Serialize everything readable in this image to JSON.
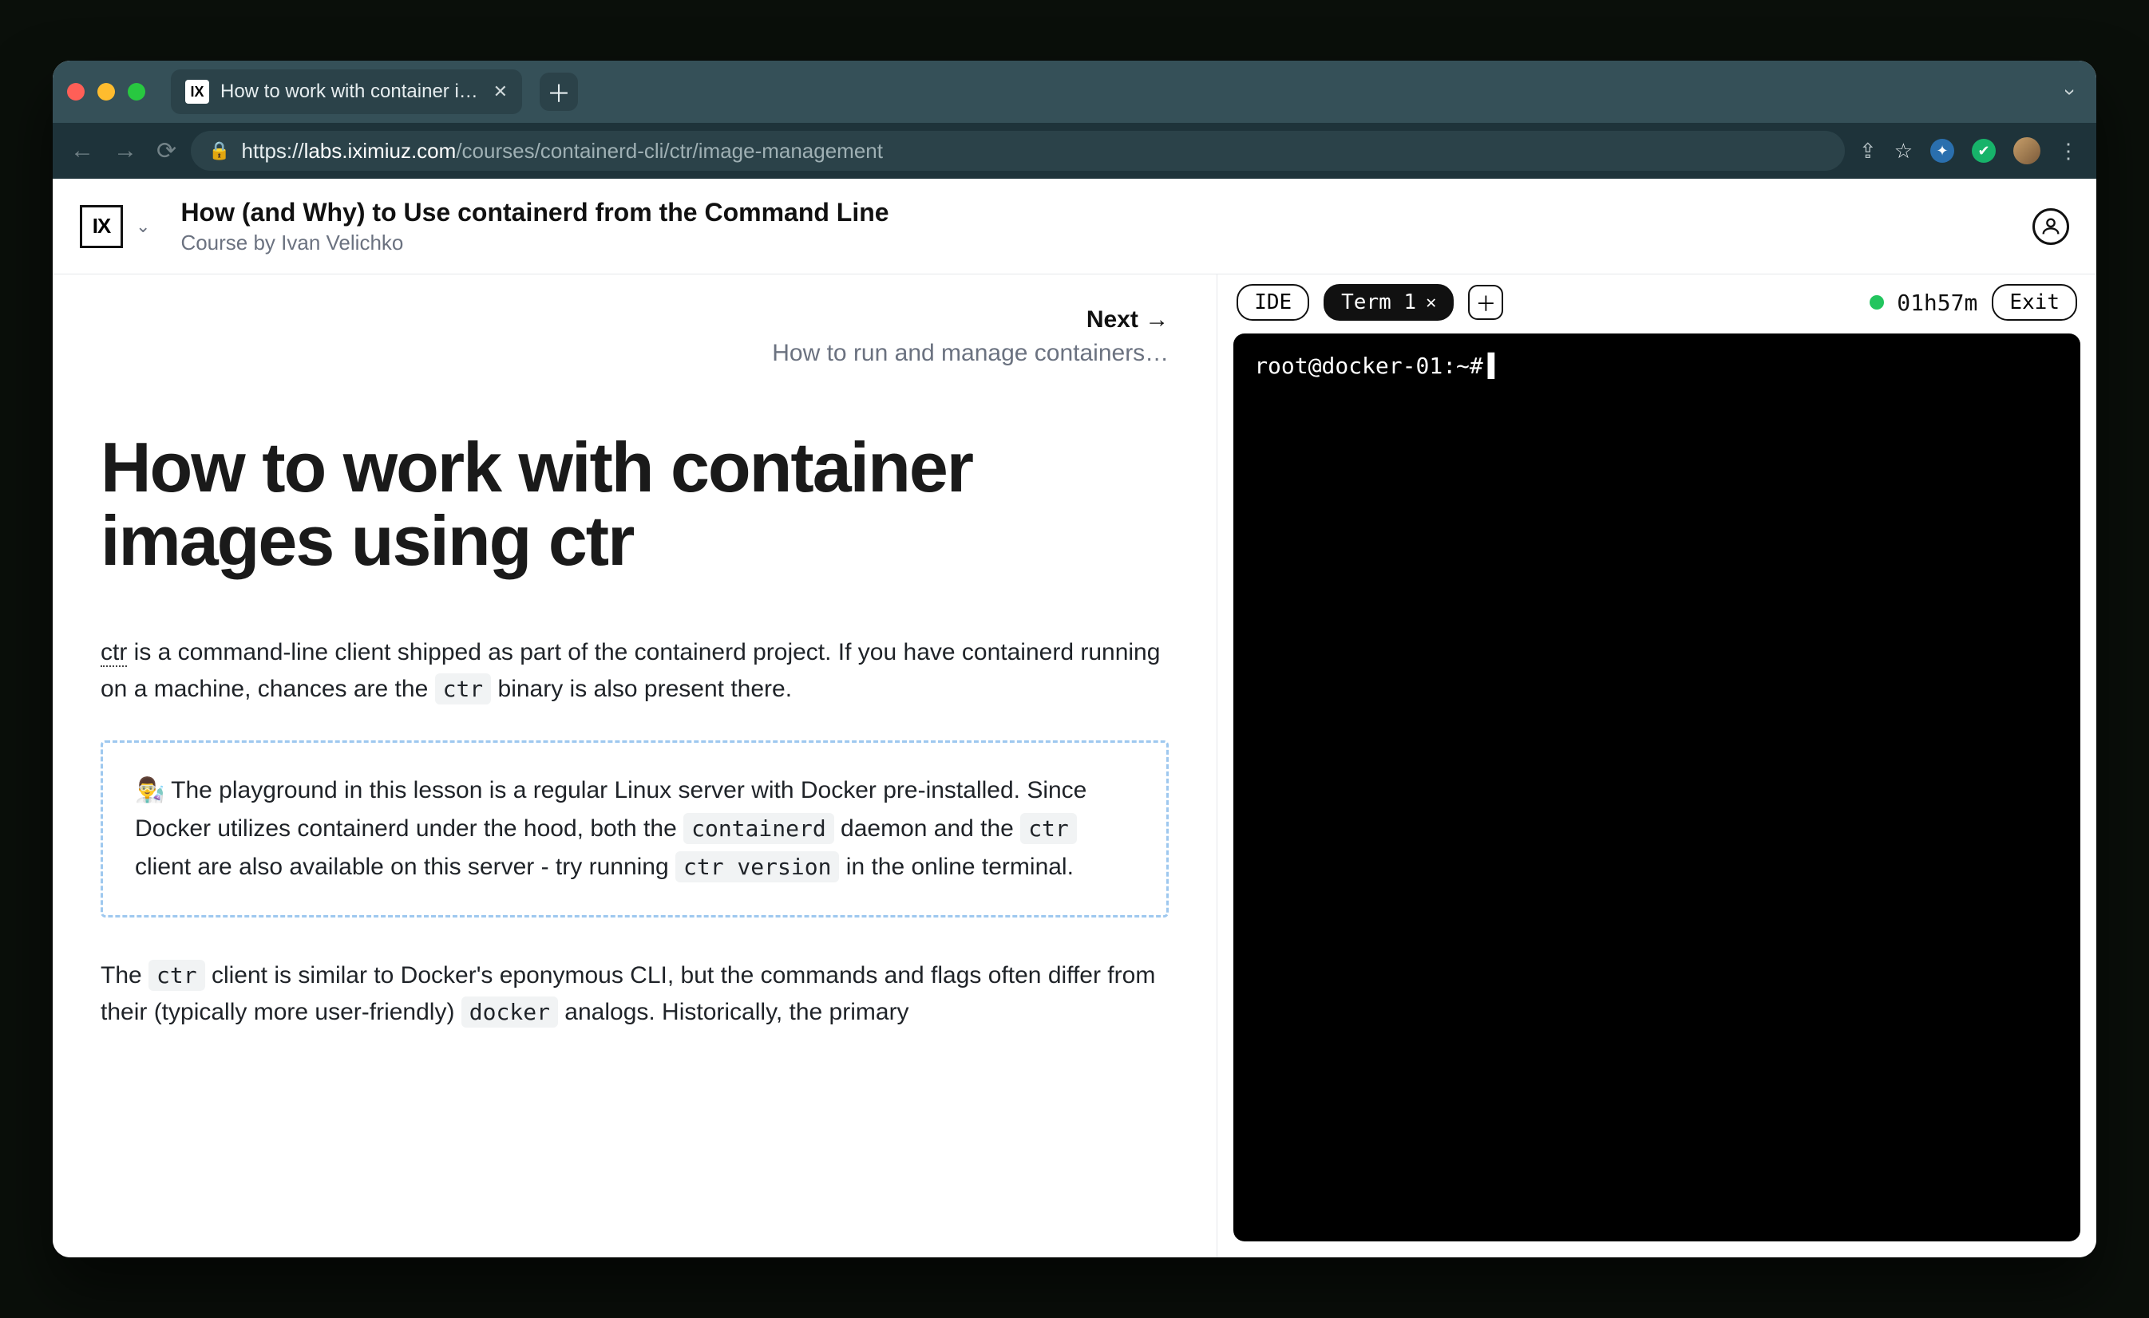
{
  "browser": {
    "tab_title": "How to work with container ima…",
    "url_proto": "https://",
    "url_host": "labs.iximiuz.com",
    "url_path": "/courses/containerd-cli/ctr/image-management"
  },
  "header": {
    "logo_text": "IX",
    "title": "How (and Why) to Use containerd from the Command Line",
    "subtitle": "Course by Ivan Velichko"
  },
  "nav": {
    "next_label": "Next →",
    "next_subtitle": "How to run and manage containers…"
  },
  "article": {
    "h1": "How to work with container images using ctr",
    "p1_lead": "ctr",
    "p1_rest_a": " is a command-line client shipped as part of the containerd project. If you have containerd running on a machine, chances are the ",
    "p1_code": "ctr",
    "p1_rest_b": " binary is also present there.",
    "callout_a": "👨‍🔬 The playground in this lesson is a regular Linux server with Docker pre-installed. Since Docker utilizes containerd under the hood, both the ",
    "callout_code1": "containerd",
    "callout_b": " daemon and the ",
    "callout_code2": "ctr",
    "callout_c": " client are also available on this server - try running ",
    "callout_code3": "ctr version",
    "callout_d": " in the online terminal.",
    "p2_a": "The ",
    "p2_code1": "ctr",
    "p2_b": " client is similar to Docker's eponymous CLI, but the commands and flags often differ from their (typically more user-friendly) ",
    "p2_code2": "docker",
    "p2_c": " analogs. Historically, the primary"
  },
  "playground": {
    "ide_tab": "IDE",
    "term_tab": "Term 1",
    "timer": "01h57m",
    "exit": "Exit",
    "prompt": "root@docker-01:~#"
  }
}
